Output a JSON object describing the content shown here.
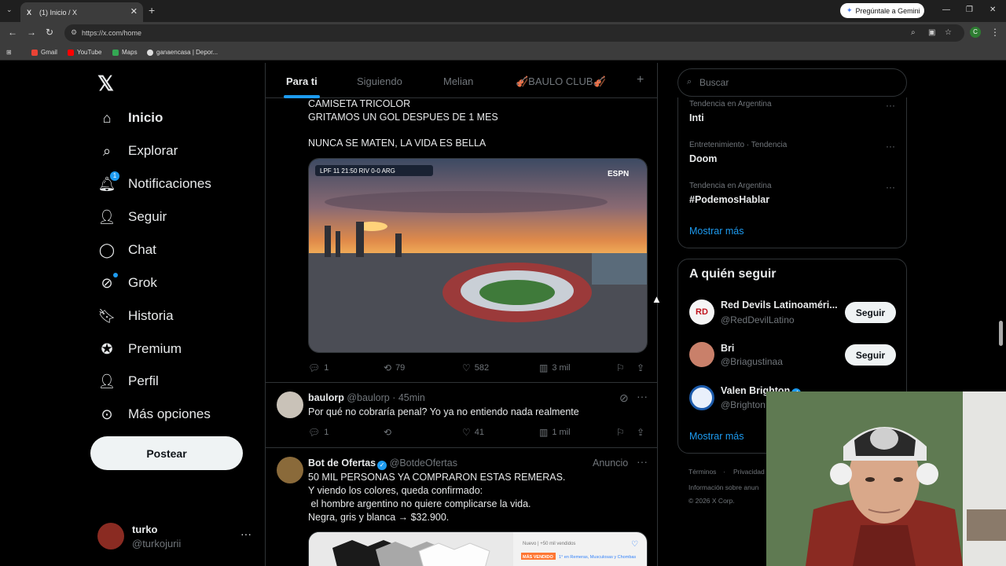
{
  "browser": {
    "tab_title": "(1) Inicio / X",
    "tab_favicon": "X",
    "new_tab": "+",
    "gemini_button": "Pregúntale a Gemini",
    "url": "https://x.com/home",
    "profile_initial": "C",
    "bookmarks": [
      "Gmail",
      "YouTube",
      "Maps",
      "ganaencasa | Depor..."
    ]
  },
  "sidebar": {
    "items": [
      {
        "label": "Inicio",
        "icon": "home-icon"
      },
      {
        "label": "Explorar",
        "icon": "search-icon"
      },
      {
        "label": "Notificaciones",
        "icon": "bell-icon",
        "badge": "1"
      },
      {
        "label": "Seguir",
        "icon": "person-add-icon"
      },
      {
        "label": "Chat",
        "icon": "chat-icon"
      },
      {
        "label": "Grok",
        "icon": "grok-icon"
      },
      {
        "label": "Historia",
        "icon": "bookmark-icon"
      },
      {
        "label": "Premium",
        "icon": "verified-icon"
      },
      {
        "label": "Perfil",
        "icon": "person-icon"
      },
      {
        "label": "Más opciones",
        "icon": "more-circle-icon"
      }
    ],
    "post_button": "Postear",
    "account": {
      "name": "turko",
      "handle": "@turkojurii",
      "more": "···"
    }
  },
  "feed": {
    "tabs": [
      "Para ti",
      "Siguiendo",
      "Melian",
      "🎻BAULO CLUB🎻",
      "+"
    ],
    "tweet1": {
      "lines": [
        "CAMISETA TRICOLOR",
        "GRITAMOS UN GOL DESPUES DE 1 MES",
        "",
        "NUNCA SE MATEN, LA VIDA ES BELLA"
      ],
      "scorebug": "LPF  11  21:50  RIV 0-0 ARG",
      "watermark": "ESPN",
      "replies": "1",
      "retweets": "79",
      "likes": "582",
      "views": "3 mil"
    },
    "tweet2": {
      "name": "baulorp",
      "handle": "@baulorp",
      "time": "· 45min",
      "text": "Por qué no cobraría penal? Yo ya no entiendo nada realmente",
      "replies": "1",
      "retweets": "",
      "likes": "41",
      "views": "1 mil"
    },
    "tweet3": {
      "name": "Bot de Ofertas",
      "handle": "@BotdeOfertas",
      "ad": "Anuncio",
      "lines": [
        "50 MIL PERSONAS YA COMPRARON ESTAS REMERAS.",
        "Y viendo los colores, queda confirmado:",
        " el hombre argentino no quiere complicarse la vida.",
        "Negra, gris y blanca → $32.900."
      ],
      "ad_meta": "Nuevo  |  +50 mil vendidos",
      "ad_tag": "MÁS VENDIDO",
      "ad_cat": "1° en Remeras, Musculosas y Chombas"
    }
  },
  "right": {
    "search_placeholder": "Buscar",
    "trends": [
      {
        "meta": "Tendencia en Argentina",
        "name": "Inti"
      },
      {
        "meta": "Entretenimiento · Tendencia",
        "name": "Doom"
      },
      {
        "meta": "Tendencia en Argentina",
        "name": "#PodemosHablar"
      }
    ],
    "show_more": "Mostrar más",
    "who_to_follow": {
      "title": "A quién seguir",
      "users": [
        {
          "name": "Red Devils Latinoaméri...",
          "handle": "@RedDevilLatino",
          "button": "Seguir",
          "avatar_text": "RD"
        },
        {
          "name": "Bri",
          "handle": "@Briagustinaa",
          "button": "Seguir"
        },
        {
          "name": "Valen Brighton",
          "handle": "@Brighton"
        }
      ],
      "show_more": "Mostrar más"
    },
    "footer": [
      "Términos",
      "·",
      "Privacidad",
      "Información sobre anun",
      "© 2026 X Corp."
    ]
  },
  "colors": {
    "accent": "#1d9bf0",
    "background": "#000000",
    "border": "#2f3336",
    "muted": "#71767b"
  }
}
